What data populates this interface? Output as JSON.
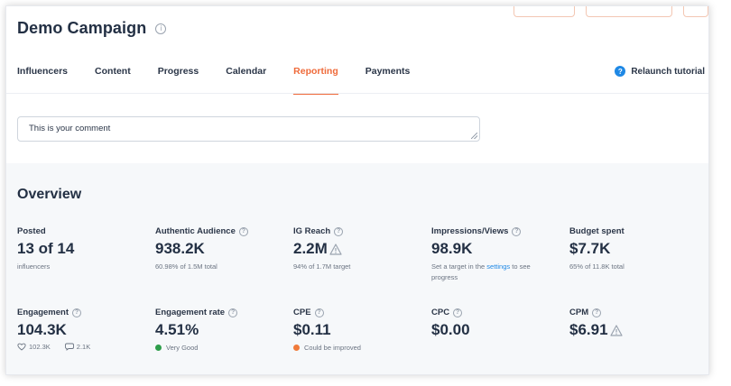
{
  "header": {
    "title": "Demo Campaign",
    "info_icon": "info-icon"
  },
  "tabs": [
    {
      "label": "Influencers"
    },
    {
      "label": "Content"
    },
    {
      "label": "Progress"
    },
    {
      "label": "Calendar"
    },
    {
      "label": "Reporting",
      "active": true
    },
    {
      "label": "Payments"
    }
  ],
  "relaunch": {
    "label": "Relaunch tutorial",
    "icon": "question-circle-icon"
  },
  "comment": {
    "value": "This is your comment"
  },
  "overview": {
    "title": "Overview"
  },
  "metrics": {
    "posted": {
      "label": "Posted",
      "value": "13 of 14",
      "sub": "influencers"
    },
    "authentic": {
      "label": "Authentic Audience",
      "value": "938.2K",
      "sub": "60.98% of 1.5M total"
    },
    "ig_reach": {
      "label": "IG Reach",
      "value": "2.2M",
      "sub": "94% of 1.7M target"
    },
    "impressions": {
      "label": "Impressions/Views",
      "value": "98.9K",
      "sub_pre": "Set a target in the ",
      "sub_link": "settings",
      "sub_post": " to see progress"
    },
    "budget": {
      "label": "Budget spent",
      "value": "$7.7K",
      "sub": "65% of 11.8K total"
    },
    "engagement": {
      "label": "Engagement",
      "value": "104.3K",
      "likes": "102.3K",
      "comments": "2.1K"
    },
    "engagement_rate": {
      "label": "Engagement rate",
      "value": "4.51%",
      "status": "Very Good",
      "status_color": "#2e9d4a"
    },
    "cpe": {
      "label": "CPE",
      "value": "$0.11",
      "status": "Could be improved",
      "status_color": "#f07a3a"
    },
    "cpc": {
      "label": "CPC",
      "value": "$0.00"
    },
    "cpm": {
      "label": "CPM",
      "value": "$6.91"
    }
  },
  "colors": {
    "accent": "#ef6a3a",
    "link": "#1e88e5",
    "text": "#233044"
  }
}
